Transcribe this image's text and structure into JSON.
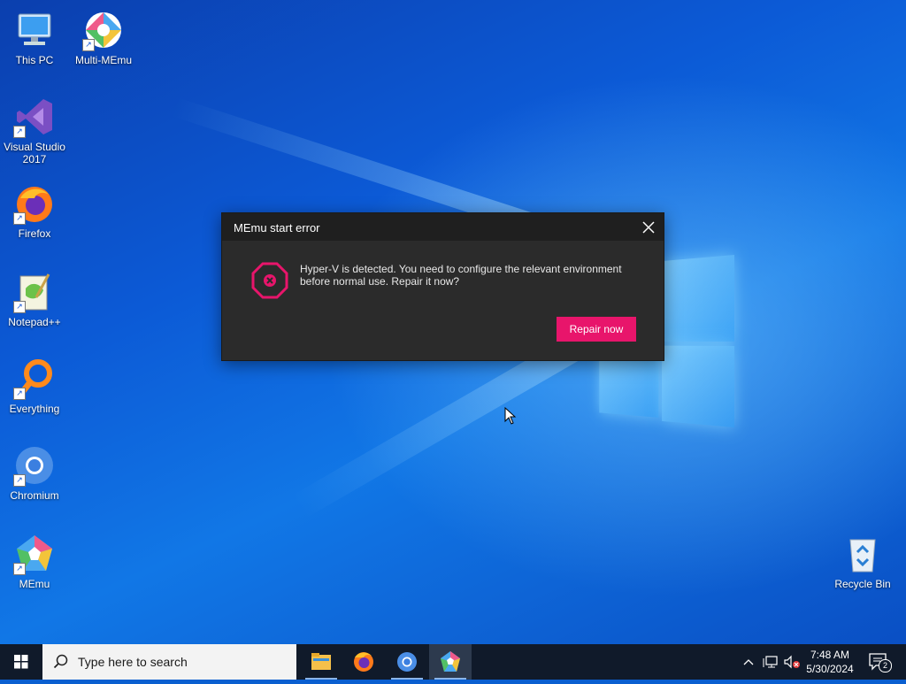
{
  "desktop": {
    "icons": [
      {
        "label": "This PC",
        "icon": "this-pc-icon"
      },
      {
        "label": "Multi-MEmu",
        "icon": "multi-memu-icon"
      },
      {
        "label": "Visual Studio 2017",
        "icon": "visual-studio-icon"
      },
      {
        "label": "Firefox",
        "icon": "firefox-icon"
      },
      {
        "label": "Notepad++",
        "icon": "notepad-plus-plus-icon"
      },
      {
        "label": "Everything",
        "icon": "everything-search-icon"
      },
      {
        "label": "Chromium",
        "icon": "chromium-icon"
      },
      {
        "label": "MEmu",
        "icon": "memu-icon"
      },
      {
        "label": "Recycle Bin",
        "icon": "recycle-bin-icon"
      }
    ]
  },
  "dialog": {
    "title": "MEmu start error",
    "message": "Hyper-V is detected. You need to configure the relevant environment before normal use. Repair it now?",
    "button_label": "Repair now",
    "accent_color": "#e8156b"
  },
  "taskbar": {
    "search_placeholder": "Type here to search",
    "apps": [
      "file-explorer-icon",
      "firefox-icon",
      "chromium-icon",
      "memu-icon"
    ],
    "time": "7:48 AM",
    "date": "5/30/2024",
    "notification_count": "2"
  }
}
